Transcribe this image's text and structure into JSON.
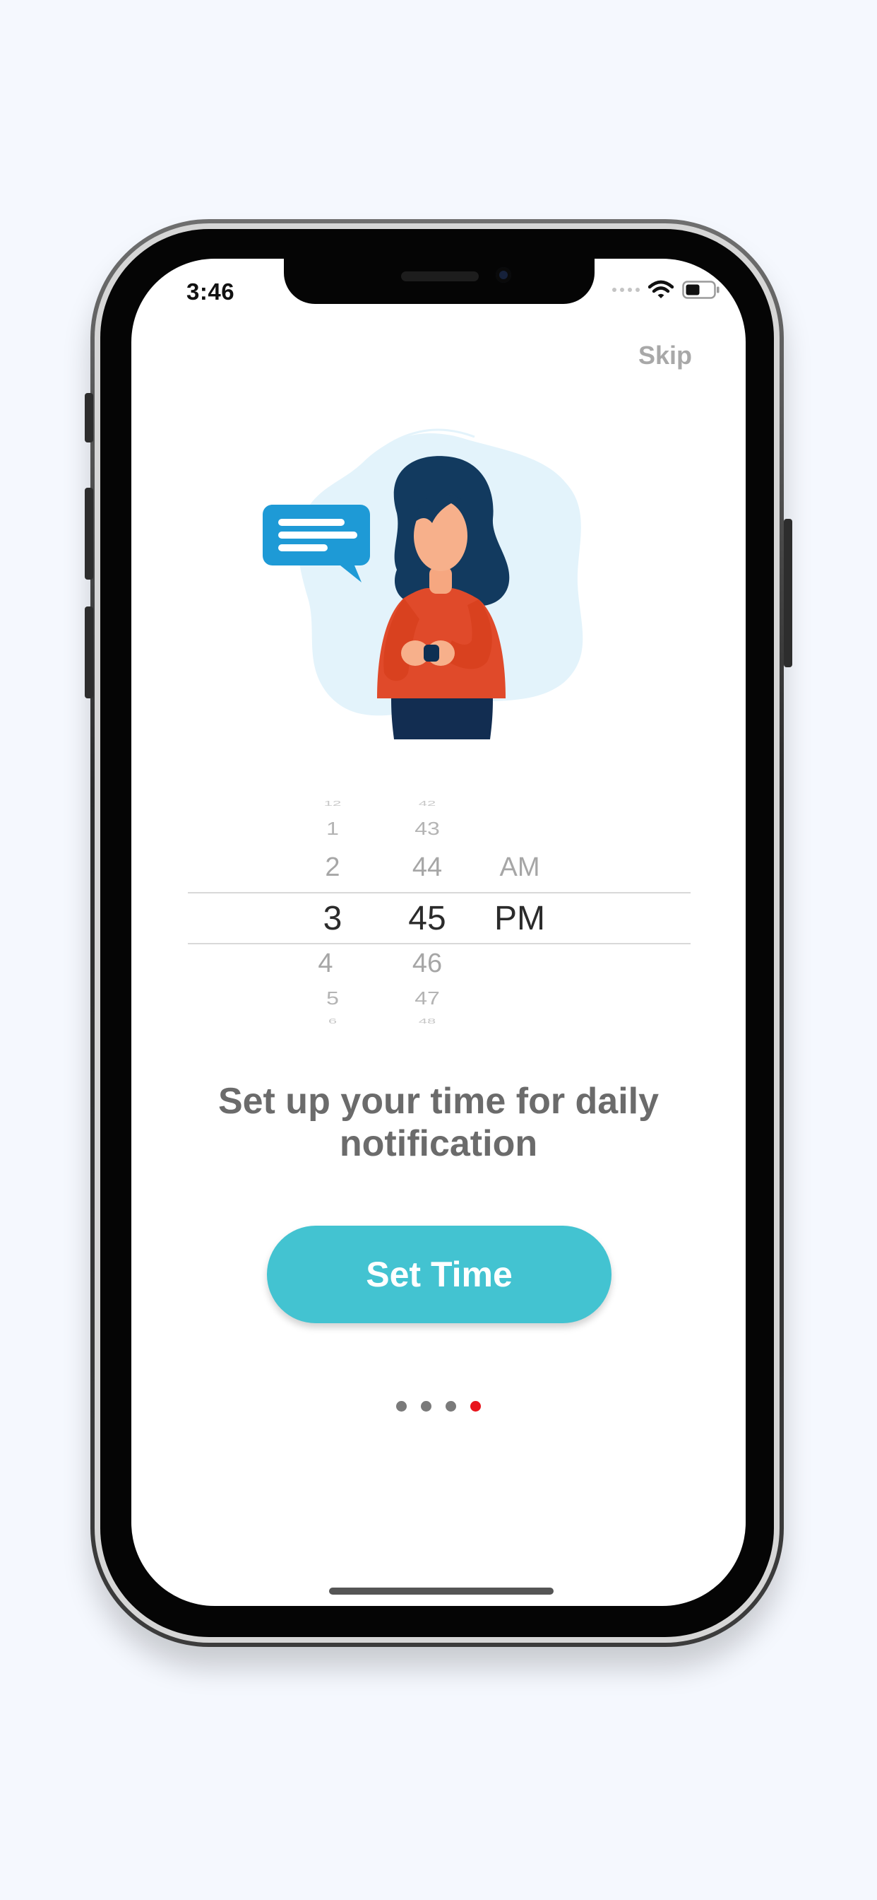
{
  "status_bar": {
    "time": "3:46",
    "wifi_icon": "wifi-icon",
    "battery_icon": "battery-icon",
    "signal_icon": "signal-dots-icon"
  },
  "onboarding": {
    "skip_label": "Skip",
    "illustration": "woman-with-smartwatch-and-message-bubble",
    "message": "Set up your time for daily notification",
    "cta_label": "Set Time",
    "page_count": 4,
    "active_page_index": 3
  },
  "time_picker": {
    "hours": [
      "12",
      "1",
      "2",
      "3",
      "4",
      "5",
      "6"
    ],
    "minutes": [
      "42",
      "43",
      "44",
      "45",
      "46",
      "47",
      "48"
    ],
    "periods": [
      "AM",
      "PM"
    ],
    "selected": {
      "hour": "3",
      "minute": "45",
      "period": "PM"
    }
  },
  "colors": {
    "page_background": "#f5f8fe",
    "cta_background": "#43c3d1",
    "active_dot": "#e8141c",
    "inactive_dot": "#7a7a7a",
    "message_text": "#6b6b6b",
    "skip_text": "#a8a8a8"
  }
}
